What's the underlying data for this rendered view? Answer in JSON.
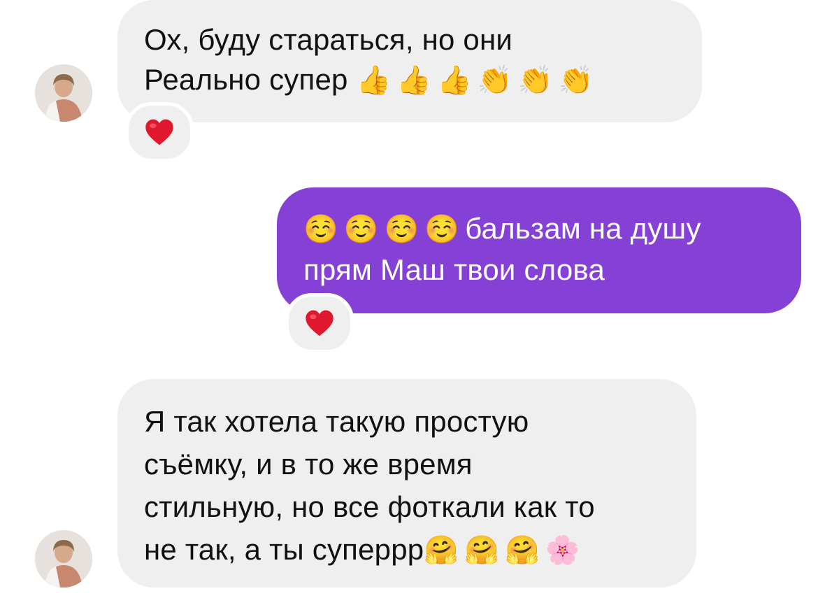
{
  "messages": [
    {
      "direction": "incoming",
      "lines": [
        "Ох, буду стараться, но они",
        "Реально супер"
      ],
      "emoji": "👍👍👍👏👏👏",
      "reaction": "❤️"
    },
    {
      "direction": "outgoing",
      "lines": [
        "бальзам на душу",
        "прям Маш твои слова"
      ],
      "emoji": "☺️☺️☺️☺️",
      "reaction": "❤️"
    },
    {
      "direction": "incoming",
      "lines": [
        "Я так хотела такую простую",
        "съёмку, и в то же время",
        "стильную, но все фоткали как то",
        "не так, а ты суперрр"
      ],
      "emoji": "🤗🤗🤗🌸"
    }
  ],
  "icons": {
    "reaction": "heart-icon",
    "avatar": "user-avatar-photo"
  },
  "colors": {
    "incoming_bubble": "#efefef",
    "outgoing_bubble": "#8540d6",
    "heart": "#e0182d"
  }
}
